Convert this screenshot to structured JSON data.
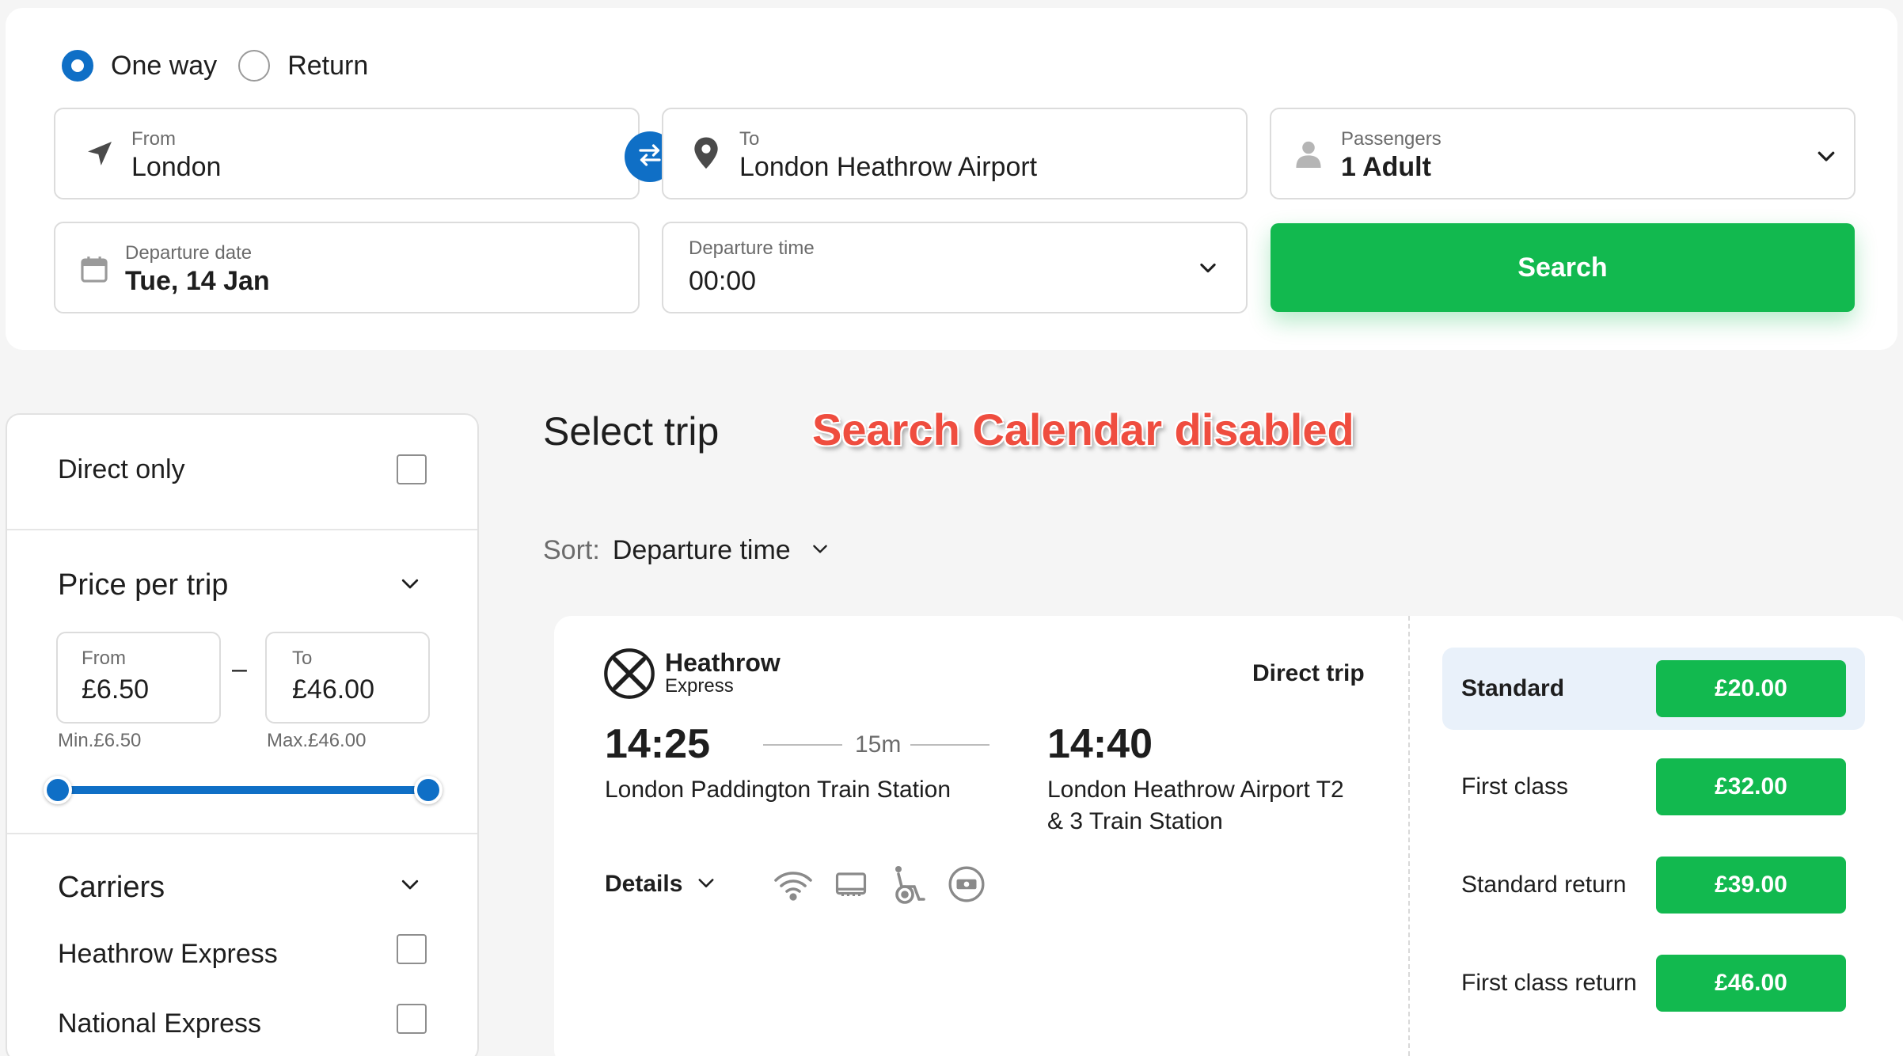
{
  "trip_type": {
    "one_way_label": "One way",
    "return_label": "Return",
    "selected": "One way"
  },
  "from": {
    "label": "From",
    "value": "London",
    "icon": "navigation-arrow-icon"
  },
  "to": {
    "label": "To",
    "value": "London Heathrow Airport",
    "icon": "map-pin-icon"
  },
  "passengers": {
    "label": "Passengers",
    "value": "1 Adult",
    "icon": "person-icon"
  },
  "departure_date": {
    "label": "Departure date",
    "value": "Tue, 14 Jan",
    "icon": "calendar-icon"
  },
  "departure_time": {
    "label": "Departure time",
    "value": "00:00"
  },
  "search_button": {
    "label": "Search"
  },
  "overlay_annotation": "Search Calendar disabled",
  "filters": {
    "direct_only": {
      "label": "Direct only",
      "checked": false
    },
    "price": {
      "title": "Price per trip",
      "from_label": "From",
      "from_value": "£6.50",
      "to_label": "To",
      "to_value": "£46.00",
      "separator": "–",
      "min_label": "Min.£6.50",
      "max_label": "Max.£46.00",
      "slider_range_fraction": [
        0,
        1
      ]
    },
    "carriers": {
      "title": "Carriers",
      "items": [
        {
          "label": "Heathrow Express",
          "checked": false
        },
        {
          "label": "National Express",
          "checked": false
        }
      ]
    }
  },
  "results": {
    "title": "Select trip",
    "sort_label": "Sort:",
    "sort_value": "Departure time",
    "trip": {
      "carrier_name_line1": "Heathrow",
      "carrier_name_line2": "Express",
      "trip_type": "Direct trip",
      "departure_time": "14:25",
      "duration": "15m",
      "arrival_time": "14:40",
      "origin": "London Paddington Train Station",
      "destination_line1": "London Heathrow Airport T2",
      "destination_line2": "& 3 Train Station",
      "details_label": "Details",
      "amenities": [
        "wifi-icon",
        "power-outlet-icon",
        "wheelchair-icon",
        "ticket-refund-icon"
      ],
      "fares": [
        {
          "name": "Standard",
          "price": "£20.00",
          "selected": true
        },
        {
          "name": "First class",
          "price": "£32.00",
          "selected": false
        },
        {
          "name": "Standard return",
          "price": "£39.00",
          "selected": false
        },
        {
          "name": "First class return",
          "price": "£46.00",
          "selected": false
        }
      ]
    }
  },
  "colors": {
    "accent_blue": "#0f6fc6",
    "cta_green": "#12b94f",
    "annotation_red": "#ef4d3f",
    "selected_fare_bg": "#e9f1fa"
  }
}
